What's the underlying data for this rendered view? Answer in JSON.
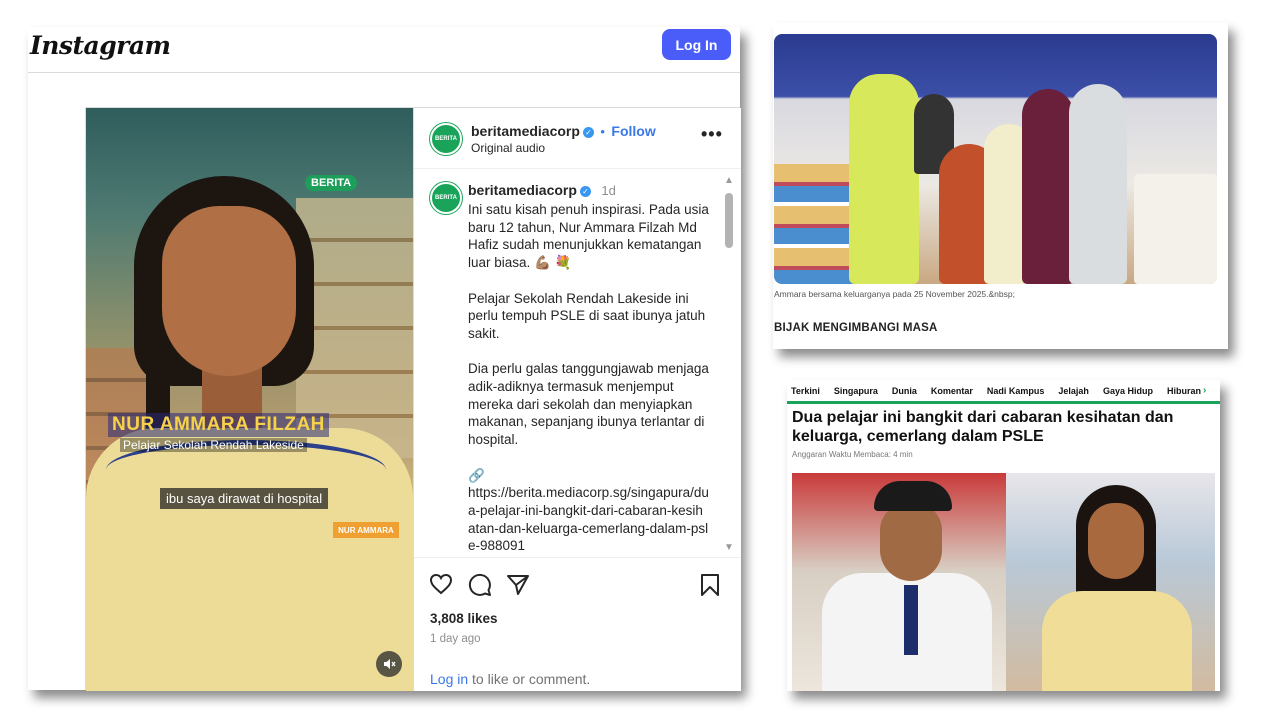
{
  "instagram": {
    "logo": "Instagram",
    "login_button": "Log In",
    "video": {
      "watermark": "BERITA",
      "name_overlay": "NUR AMMARA FILZAH",
      "school_overlay": "Pelajar Sekolah Rendah Lakeside",
      "subtitle": "ibu saya dirawat di hospital",
      "name_tag": "NUR AMMARA"
    },
    "header": {
      "username": "beritamediacorp",
      "follow": "Follow",
      "audio": "Original audio",
      "more": "•••"
    },
    "caption": {
      "username": "beritamediacorp",
      "time": "1d",
      "paragraphs": [
        "Ini satu kisah penuh inspirasi. Pada usia baru 12 tahun, Nur Ammara Filzah Md Hafiz sudah menunjukkan kematangan luar biasa. 💪🏽 💐",
        "Pelajar Sekolah Rendah Lakeside ini perlu tempuh PSLE di saat ibunya jatuh sakit.",
        "Dia perlu galas tanggungjawab menjaga adik-adiknya termasuk menjemput mereka dari sekolah dan menyiapkan makanan, sepanjang ibunya terlantar di hospital.",
        "🔗\nhttps://berita.mediacorp.sg/singapura/dua-pelajar-ini-bangkit-dari-cabaran-kesihatan-dan-keluarga-cemerlang-dalam-psle-988091"
      ]
    },
    "likes": "3,808 likes",
    "posted": "1 day ago",
    "login_prompt_link": "Log in",
    "login_prompt_rest": " to like or comment."
  },
  "photo_article": {
    "caption": "Ammara bersama keluarganya pada 25 November 2025.&nbsp;",
    "subheading": "BIJAK MENGIMBANGI MASA"
  },
  "news_article": {
    "nav": [
      "Terkini",
      "Singapura",
      "Dunia",
      "Komentar",
      "Nadi Kampus",
      "Jelajah",
      "Gaya Hidup",
      "Hiburan"
    ],
    "title": "Dua pelajar ini bangkit dari cabaran kesihatan dan keluarga, cemerlang dalam PSLE",
    "read_time": "Anggaran Waktu Membaca: 4 min"
  },
  "colors": {
    "ig_blue": "#4a5df9",
    "link_blue": "#3b78e7",
    "berita_green": "#1aa45a"
  }
}
